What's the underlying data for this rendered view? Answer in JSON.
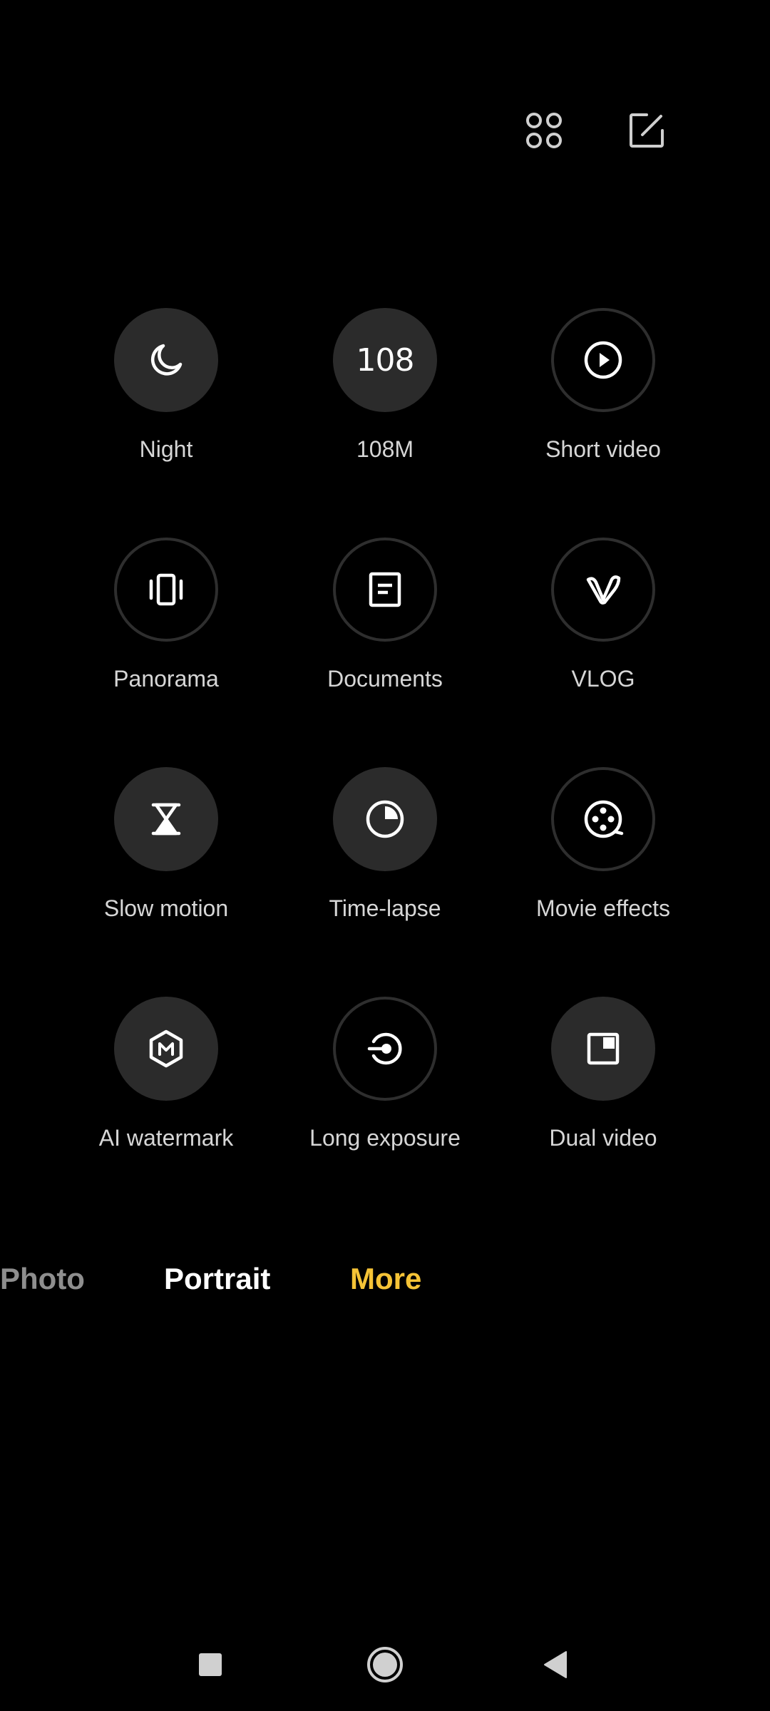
{
  "toolbar": {
    "grid_icon": "grid-icon",
    "edit_icon": "edit-icon"
  },
  "modes": [
    {
      "label": "Night",
      "icon": "moon-icon",
      "style": "filled"
    },
    {
      "label": "108M",
      "icon": "108-icon",
      "icon_text": "108",
      "style": "filled"
    },
    {
      "label": "Short video",
      "icon": "play-icon",
      "style": "outline"
    },
    {
      "label": "Panorama",
      "icon": "panorama-icon",
      "style": "outline"
    },
    {
      "label": "Documents",
      "icon": "document-icon",
      "style": "outline"
    },
    {
      "label": "VLOG",
      "icon": "vlog-icon",
      "style": "outline"
    },
    {
      "label": "Slow motion",
      "icon": "hourglass-icon",
      "style": "filled"
    },
    {
      "label": "Time-lapse",
      "icon": "timer-icon",
      "style": "filled"
    },
    {
      "label": "Movie effects",
      "icon": "film-reel-icon",
      "style": "outline"
    },
    {
      "label": "AI watermark",
      "icon": "watermark-icon",
      "style": "filled"
    },
    {
      "label": "Long exposure",
      "icon": "long-exposure-icon",
      "style": "outline"
    },
    {
      "label": "Dual video",
      "icon": "dual-video-icon",
      "style": "filled"
    }
  ],
  "tabs": {
    "photo": "Photo",
    "portrait": "Portrait",
    "more": "More",
    "active_color": "#f5c336"
  },
  "navbar": {
    "recents_icon": "square-icon",
    "home_icon": "circle-icon",
    "back_icon": "triangle-back-icon"
  }
}
